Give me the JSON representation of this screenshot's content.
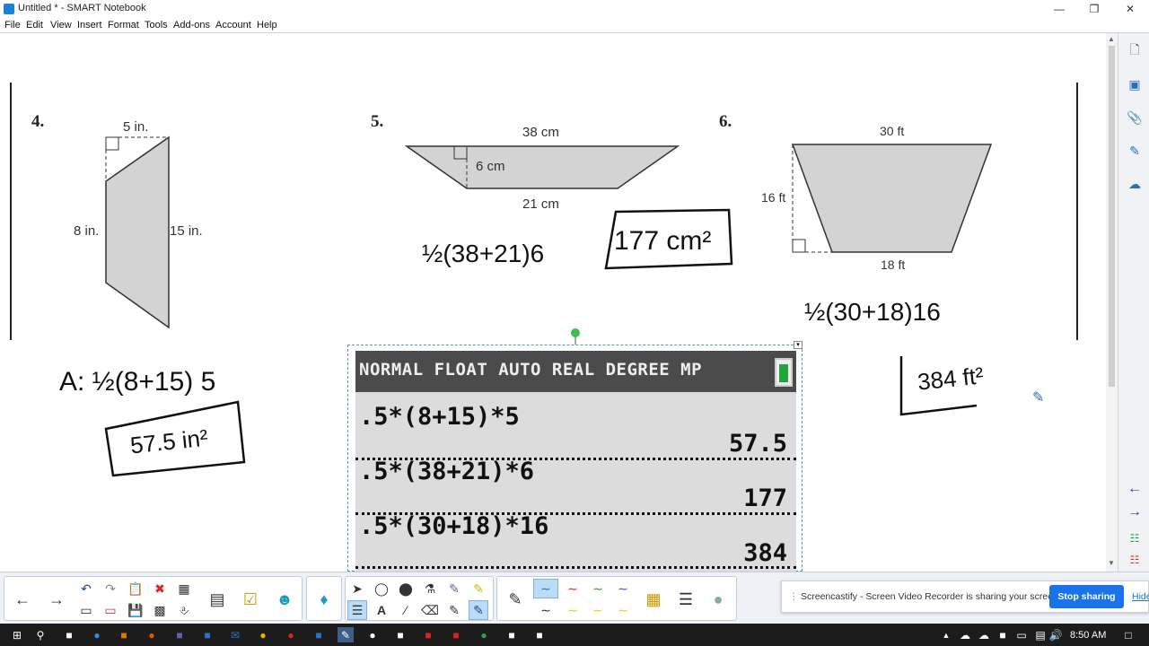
{
  "window": {
    "title": "Untitled * - SMART Notebook"
  },
  "menu": [
    "File",
    "Edit",
    "View",
    "Insert",
    "Format",
    "Tools",
    "Add-ons",
    "Account",
    "Help"
  ],
  "problems": [
    {
      "number": "4.",
      "top": "5 in.",
      "left": "8 in.",
      "right": "15 in."
    },
    {
      "number": "5.",
      "top": "38 cm",
      "height": "6 cm",
      "bottom": "21 cm"
    },
    {
      "number": "6.",
      "top": "30 ft",
      "height": "16 ft",
      "bottom": "18 ft"
    }
  ],
  "handwriting": {
    "p4_formula": "A: ½(8+15) 5",
    "p4_answer": "57.5 in²",
    "p5_formula": "½(38+21)6",
    "p5_answer": "177 cm²",
    "p6_formula": "½(30+18)16",
    "p6_answer": "384 ft²"
  },
  "calculator": {
    "status": "NORMAL FLOAT AUTO REAL DEGREE MP",
    "battery_color": "#21a53b",
    "entries": [
      {
        "expr": ".5*(8+15)*5",
        "result": "57.5"
      },
      {
        "expr": ".5*(38+21)*6",
        "result": "177"
      },
      {
        "expr": ".5*(30+18)*16",
        "result": "384"
      }
    ]
  },
  "notification": {
    "message": "Screencastify - Screen Video Recorder is sharing your screen.",
    "stop_label": "Stop sharing",
    "hide_label": "Hide"
  },
  "taskbar": {
    "time": "8:50 AM"
  },
  "colors": {
    "accent": "#1a73e8",
    "shape_fill": "#d3d3d3"
  }
}
